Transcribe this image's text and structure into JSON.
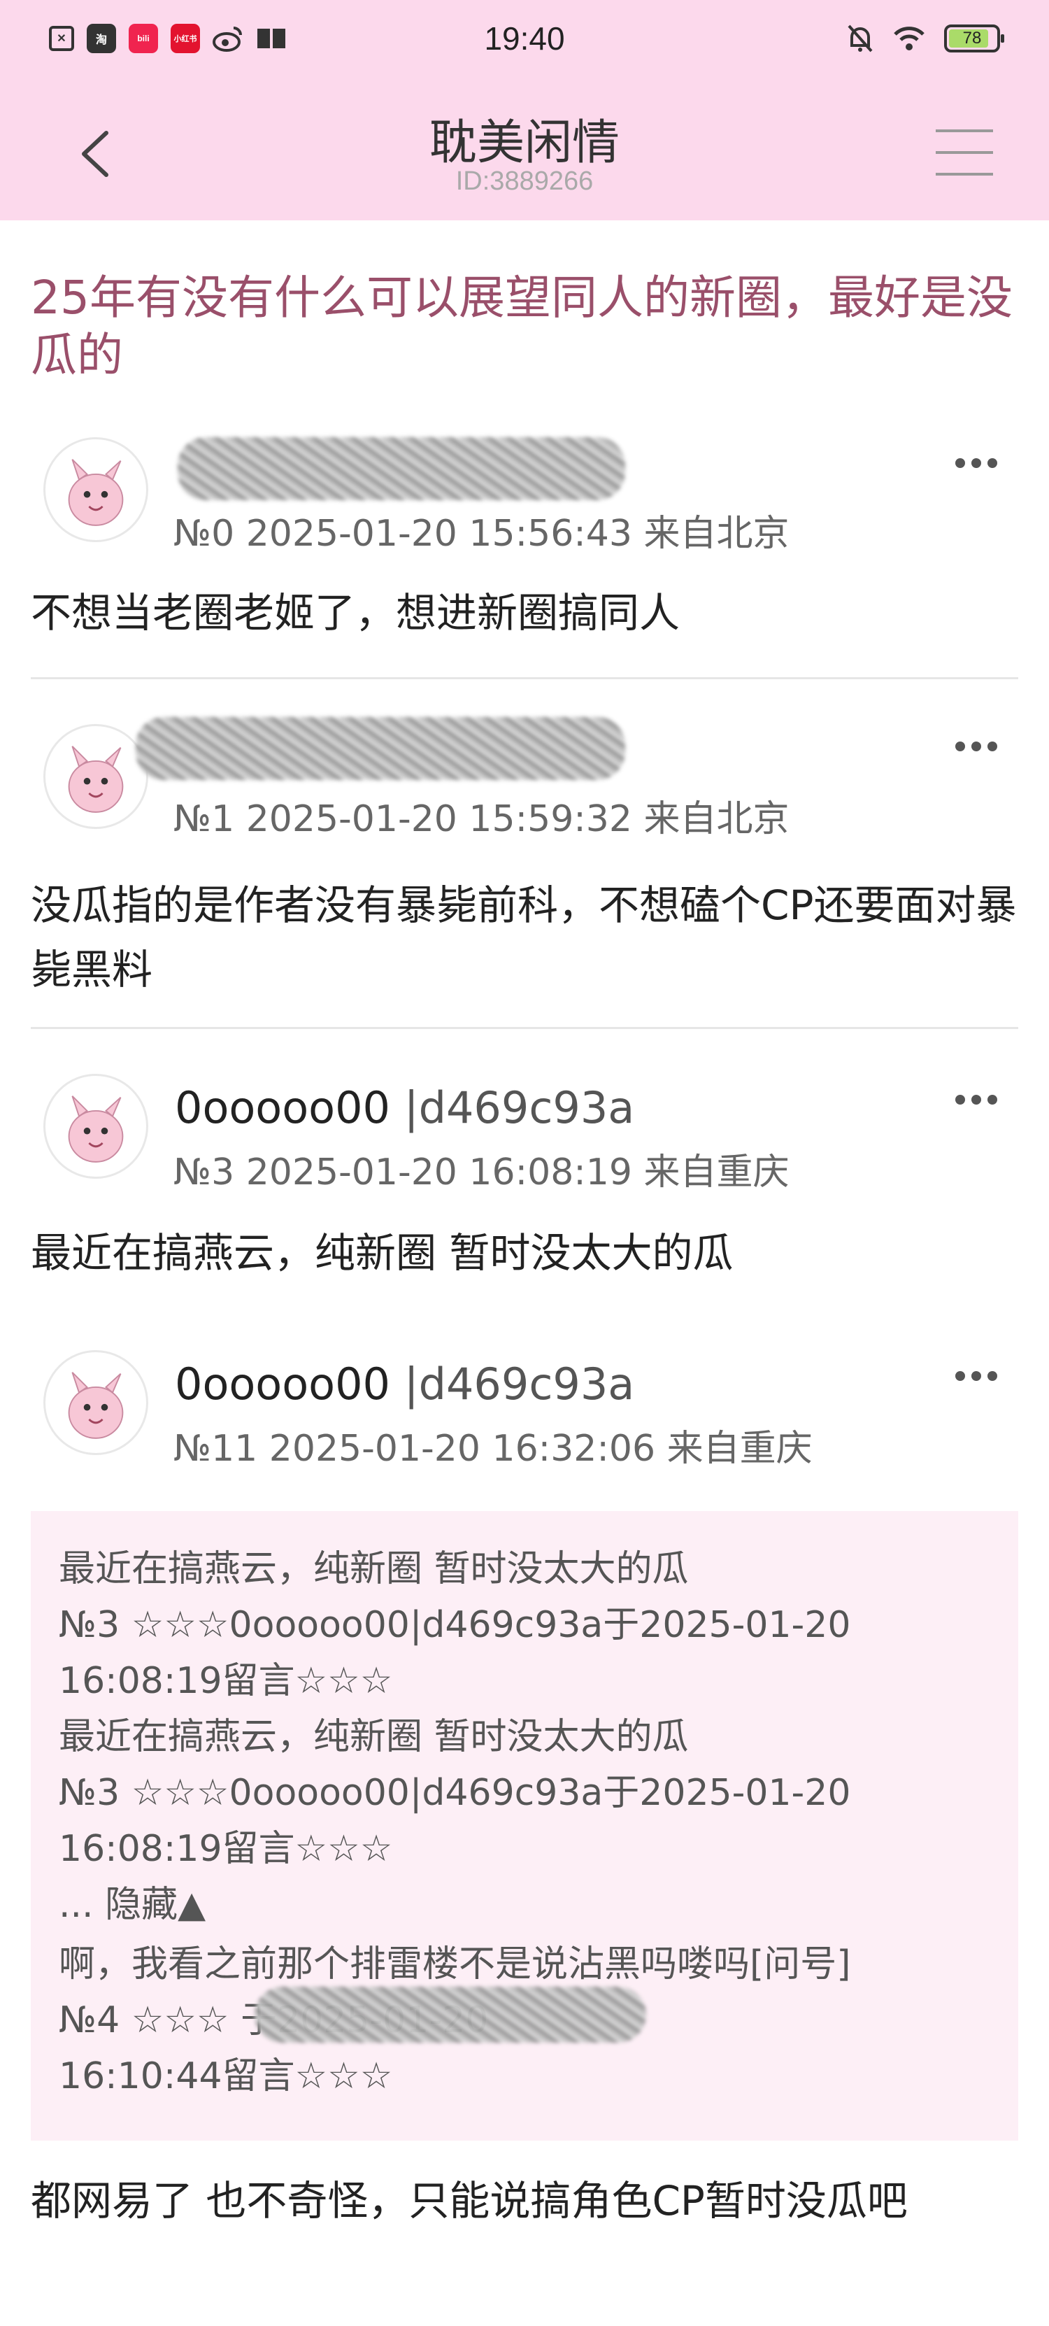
{
  "status_bar": {
    "time": "19:40",
    "battery": "78",
    "app_icons": [
      "x-box-icon",
      "taobao-icon",
      "bilibili-icon",
      "xiaohongshu-icon",
      "weibo-icon",
      "book-icon"
    ],
    "app_icon_labels": [
      "淘",
      "bili",
      "小红书"
    ]
  },
  "nav": {
    "title": "耽美闲情",
    "subtitle": "ID:3889266"
  },
  "thread": {
    "title": "25年有没有什么可以展望同人的新圈，最好是没瓜的"
  },
  "posts": [
    {
      "author": "",
      "meta": "№0 2025-01-20 15:56:43 来自北京",
      "content": "不想当老圈老姬了，想进新圈搞同人"
    },
    {
      "author": "",
      "meta": "№1 2025-01-20 15:59:32 来自北京",
      "content": "没瓜指的是作者没有暴毙前科，不想磕个CP还要面对暴毙黑料"
    },
    {
      "author_name": "0ooooo00",
      "author_uid": "|d469c93a",
      "meta": "№3 2025-01-20 16:08:19 来自重庆",
      "content": "最近在搞燕云，纯新圈 暂时没太大的瓜"
    },
    {
      "author_name": "0ooooo00",
      "author_uid": "|d469c93a",
      "meta": "№11 2025-01-20 16:32:06 来自重庆",
      "quote_lines": [
        "最近在搞燕云，纯新圈 暂时没太大的瓜",
        "№3 ☆☆☆0ooooo00|d469c93a于2025-01-20",
        "16:08:19留言☆☆☆",
        "最近在搞燕云，纯新圈 暂时没太大的瓜",
        "№3 ☆☆☆0ooooo00|d469c93a于2025-01-20",
        "16:08:19留言☆☆☆",
        "... 隐藏▲",
        "啊，我看之前那个排雷楼不是说沾黑吗喽吗[问号]",
        "№4 ☆☆☆                         于2025-01-20",
        "16:10:44留言☆☆☆"
      ],
      "content": "都网易了 也不奇怪，只能说搞角色CP暂时没瓜吧"
    }
  ]
}
